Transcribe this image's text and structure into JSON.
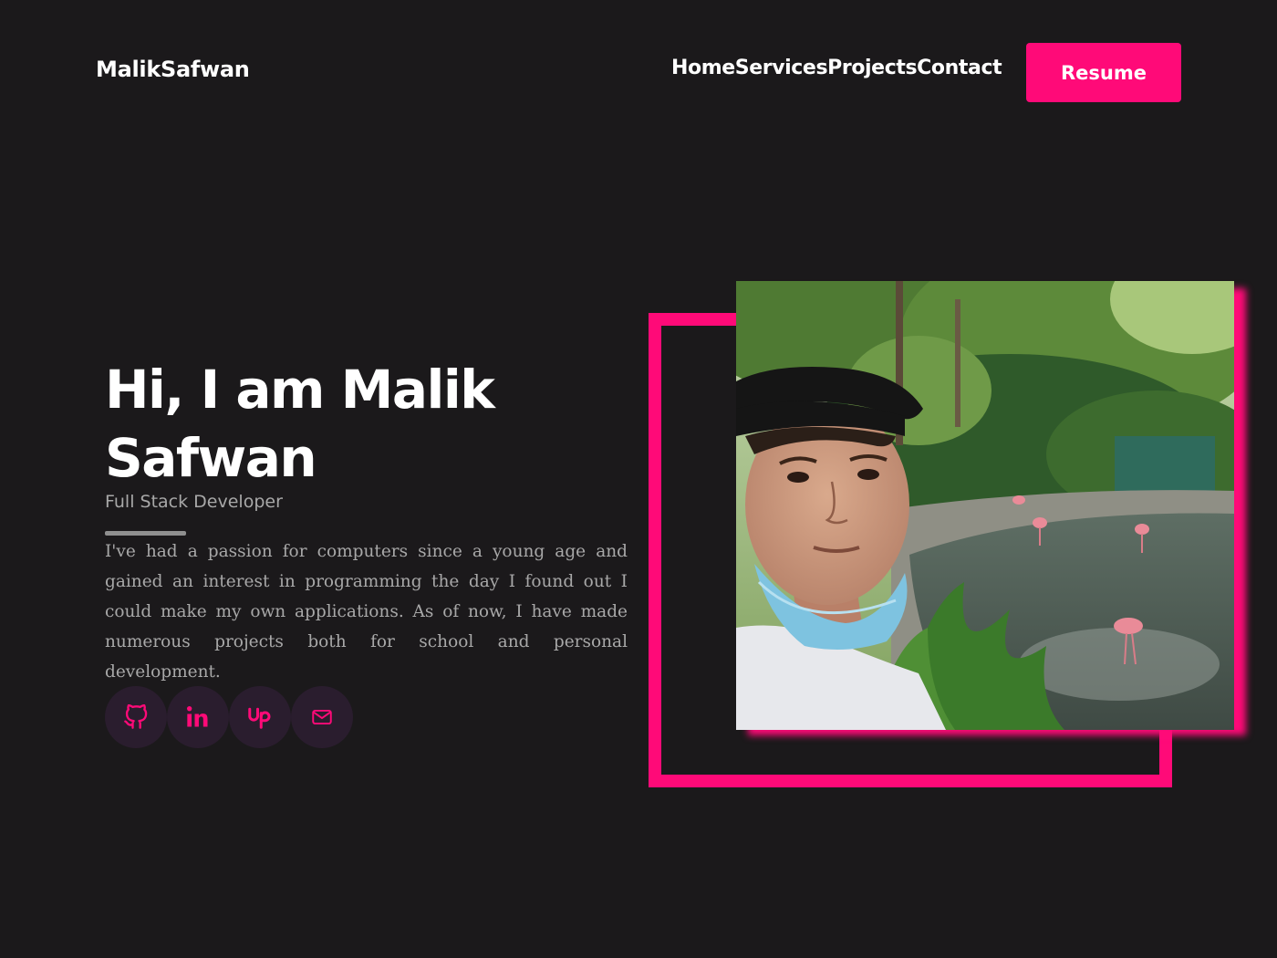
{
  "header": {
    "logo": "MalikSafwan",
    "nav": [
      {
        "label": "Home"
      },
      {
        "label": "Services"
      },
      {
        "label": "Projects"
      },
      {
        "label": "Contact"
      }
    ],
    "resume_label": "Resume"
  },
  "hero": {
    "title": "Hi, I am Malik Safwan",
    "subtitle": "Full Stack Developer",
    "bio": "I've had a passion for computers since a young age and gained an interest in programming the day I found out I could make my own applications. As of now, I have made numerous projects both for school and personal development."
  },
  "socials": [
    {
      "icon": "github-icon"
    },
    {
      "icon": "linkedin-icon"
    },
    {
      "icon": "upwork-icon"
    },
    {
      "icon": "mail-icon"
    }
  ],
  "colors": {
    "background": "#1b191b",
    "accent": "#ff0a78",
    "text": "#ffffff",
    "muted_text": "#a8a8a8",
    "social_bg": "#2a1d2e"
  }
}
